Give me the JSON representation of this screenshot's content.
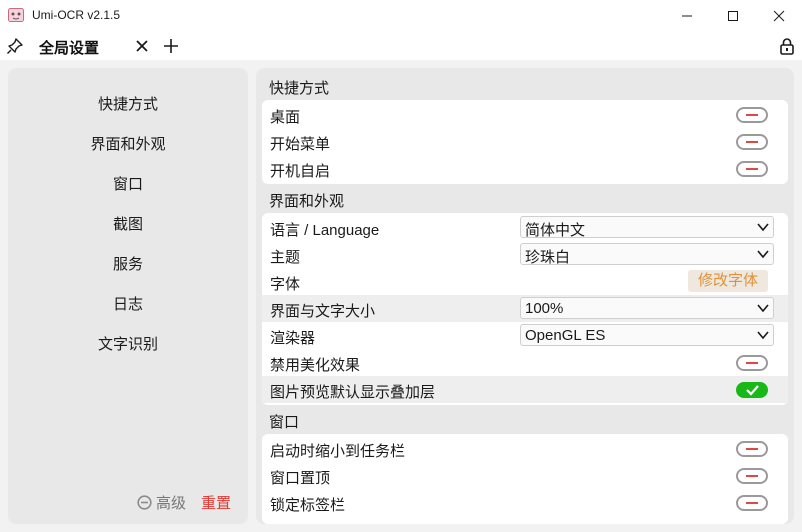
{
  "window": {
    "title": "Umi-OCR v2.1.5",
    "controls": {
      "minimize": "—",
      "maximize": "☐",
      "close": "✕"
    }
  },
  "tabs": {
    "active_label": "全局设置",
    "icons": [
      "pin-icon",
      "close-icon",
      "plus-icon",
      "lock-icon"
    ]
  },
  "sidebar": {
    "items": [
      "快捷方式",
      "界面和外观",
      "窗口",
      "截图",
      "服务",
      "日志",
      "文字识别"
    ],
    "advanced_label": "高级",
    "reset_label": "重置"
  },
  "settings": {
    "shortcuts": {
      "title": "快捷方式",
      "rows": [
        {
          "label": "桌面",
          "state": "off"
        },
        {
          "label": "开始菜单",
          "state": "off"
        },
        {
          "label": "开机自启",
          "state": "off"
        }
      ]
    },
    "appearance": {
      "title": "界面和外观",
      "language_label": "语言 / Language",
      "language_value": "简体中文",
      "theme_label": "主题",
      "theme_value": "珍珠白",
      "font_label": "字体",
      "font_button": "修改字体",
      "scale_label": "界面与文字大小",
      "scale_value": "100%",
      "renderer_label": "渲染器",
      "renderer_value": "OpenGL ES",
      "disable_effects_label": "禁用美化效果",
      "disable_effects_state": "off",
      "preview_overlay_label": "图片预览默认显示叠加层",
      "preview_overlay_state": "on"
    },
    "window": {
      "title": "窗口",
      "rows": [
        {
          "label": "启动时缩小到任务栏",
          "state": "off"
        },
        {
          "label": "窗口置顶",
          "state": "off"
        },
        {
          "label": "锁定标签栏",
          "state": "off"
        }
      ]
    }
  },
  "colors": {
    "toggle_on": "#18b818",
    "toggle_off_mark": "#e04848",
    "reset": "#e53935",
    "font_button_text": "#e0913a"
  }
}
